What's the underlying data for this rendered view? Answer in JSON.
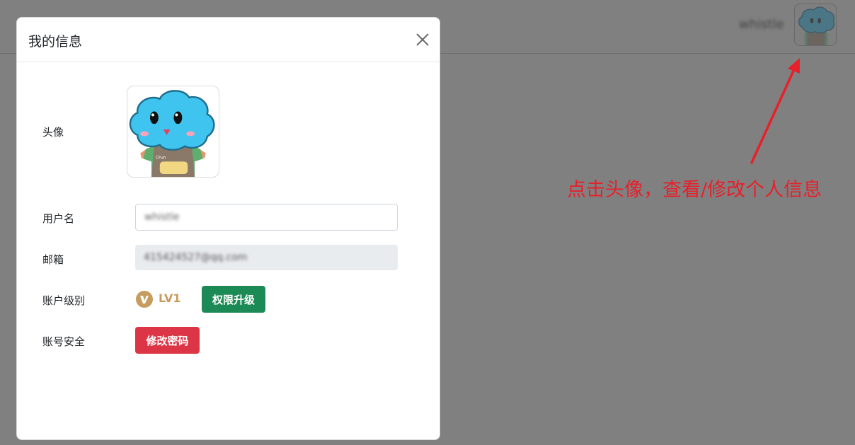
{
  "header": {
    "username": "whistle",
    "avatar_icon": "cloud-mascot-avatar"
  },
  "annotation": {
    "text": "点击头像，查看/修改个人信息",
    "color": "#e8202a"
  },
  "modal": {
    "title": "我的信息",
    "close_icon": "close-icon",
    "rows": {
      "avatar_label": "头像",
      "username_label": "用户名",
      "email_label": "邮箱",
      "level_label": "账户级别",
      "security_label": "账号安全"
    },
    "avatar": {
      "mascot_text": "CFun"
    },
    "username_value": "whistle",
    "email_value": "415424527@qq.com",
    "level": {
      "icon": "v-level-badge-icon",
      "value": "LV1"
    },
    "upgrade_button": "权限升级",
    "change_password_button": "修改密码"
  },
  "colors": {
    "overlay": "#808080",
    "upgrade": "#1c8a54",
    "danger": "#dc3545",
    "level_gold": "#c79c5f"
  }
}
